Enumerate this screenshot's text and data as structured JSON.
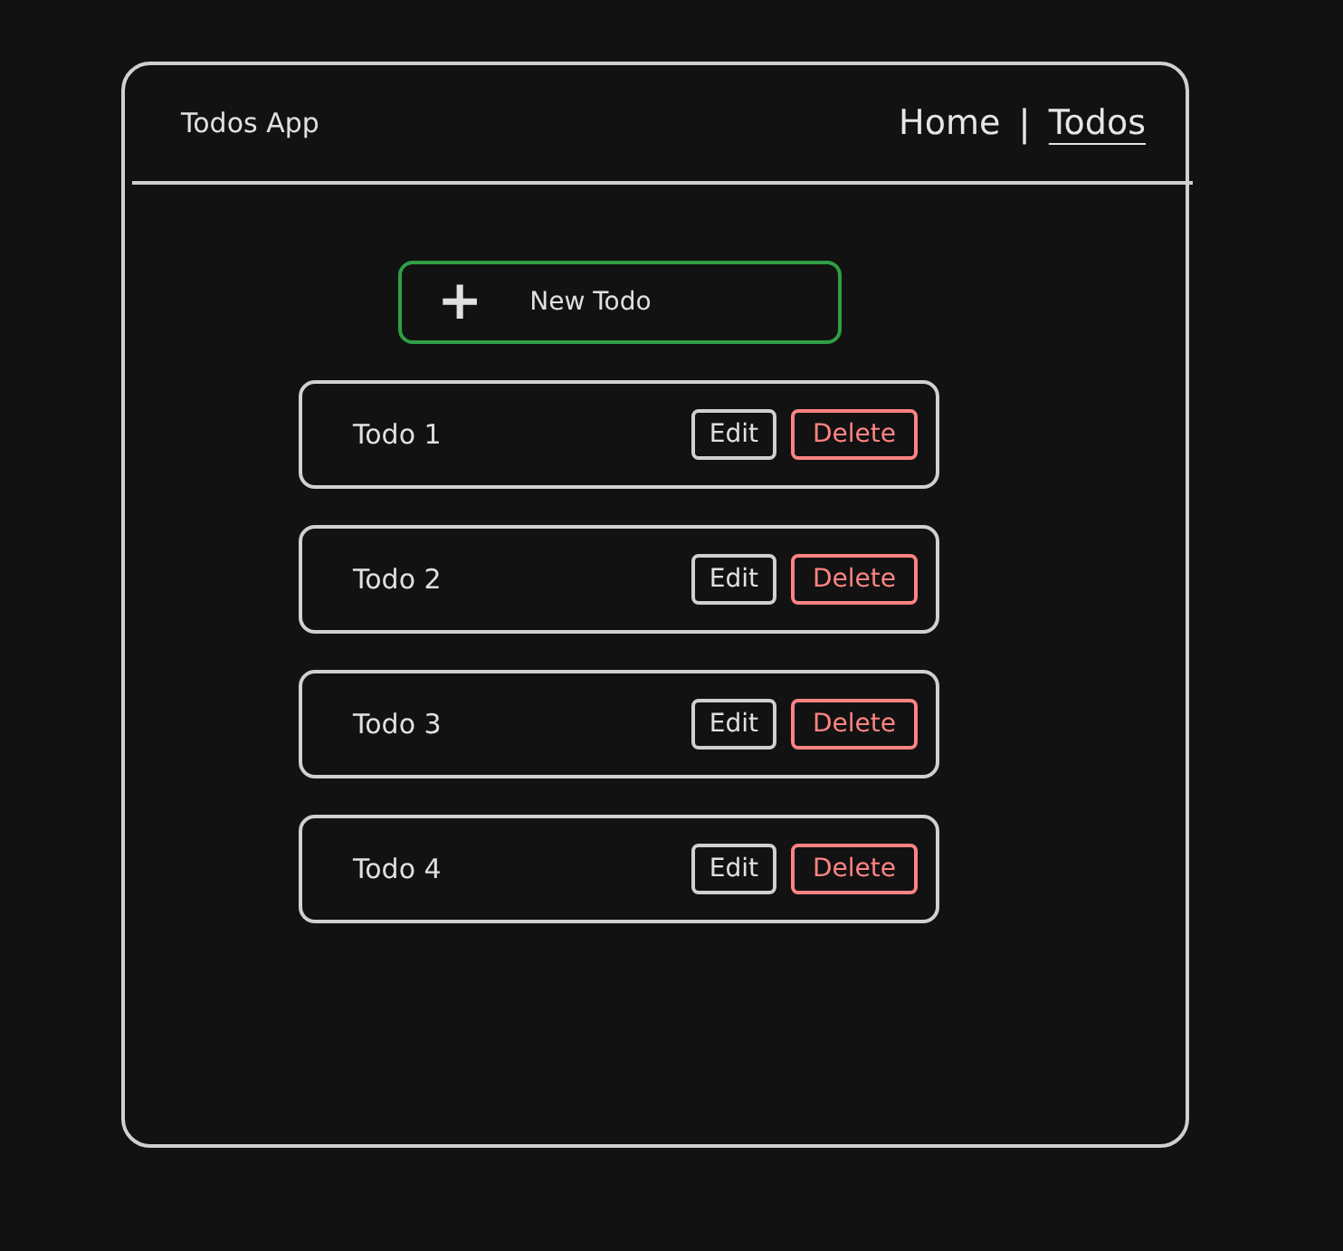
{
  "app_title": "Todos App",
  "nav": {
    "separator": "|",
    "items": [
      {
        "label": "Home",
        "selected": false
      },
      {
        "label": "Todos",
        "selected": true
      }
    ]
  },
  "new_button": {
    "icon": "+",
    "label": "New Todo"
  },
  "todos": [
    {
      "title": "Todo 1",
      "edit": "Edit",
      "delete": "Delete"
    },
    {
      "title": "Todo 2",
      "edit": "Edit",
      "delete": "Delete"
    },
    {
      "title": "Todo 3",
      "edit": "Edit",
      "delete": "Delete"
    },
    {
      "title": "Todo 4",
      "edit": "Edit",
      "delete": "Delete"
    }
  ]
}
